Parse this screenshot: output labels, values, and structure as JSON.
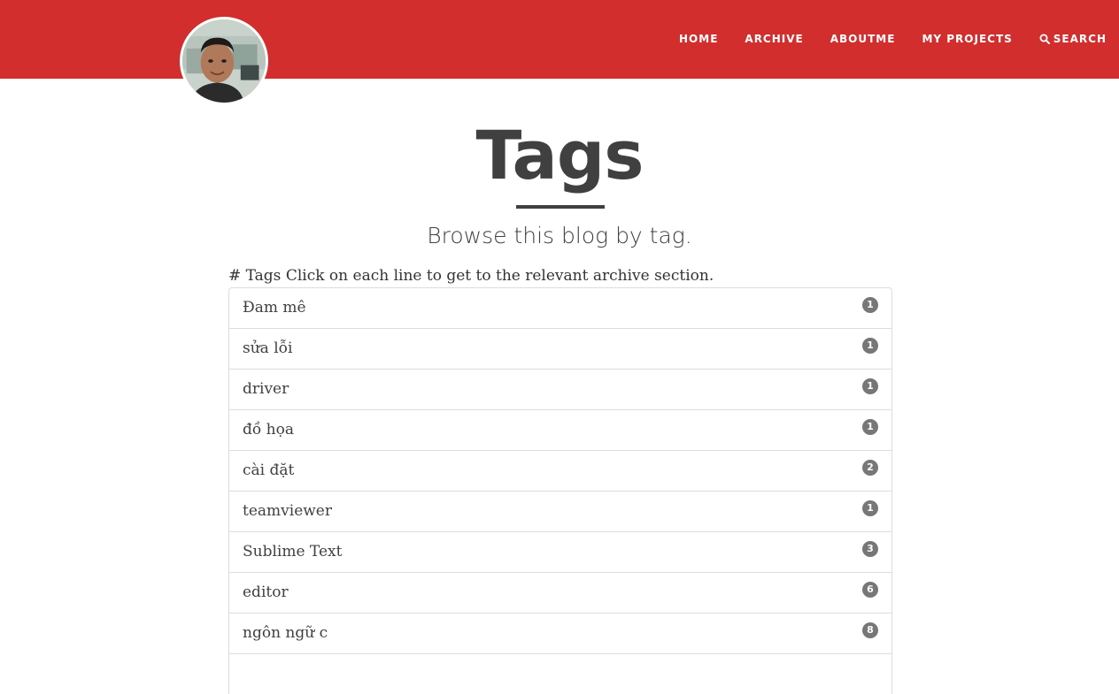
{
  "nav": {
    "home": "HOME",
    "archive": "ARCHIVE",
    "aboutme": "ABOUTME",
    "projects": "MY PROJECTS",
    "search": "SEARCH"
  },
  "header": {
    "title": "Tags",
    "subtitle": "Browse this blog by tag."
  },
  "intro": "# Tags Click on each line to get to the relevant archive section.",
  "tags": [
    {
      "name": "Đam mê",
      "count": "1"
    },
    {
      "name": "sửa lỗi",
      "count": "1"
    },
    {
      "name": "driver",
      "count": "1"
    },
    {
      "name": "đồ họa",
      "count": "1"
    },
    {
      "name": "cài đặt",
      "count": "2"
    },
    {
      "name": "teamviewer",
      "count": "1"
    },
    {
      "name": "Sublime Text",
      "count": "3"
    },
    {
      "name": "editor",
      "count": "6"
    },
    {
      "name": "ngôn ngữ c",
      "count": "8"
    },
    {
      "name": "",
      "count": ""
    }
  ],
  "icons": {
    "search": "search-icon",
    "avatar": "avatar-photo"
  },
  "colors": {
    "navbar": "#d32e2e",
    "text": "#404040",
    "badge": "#777777",
    "border": "#dddddd"
  }
}
